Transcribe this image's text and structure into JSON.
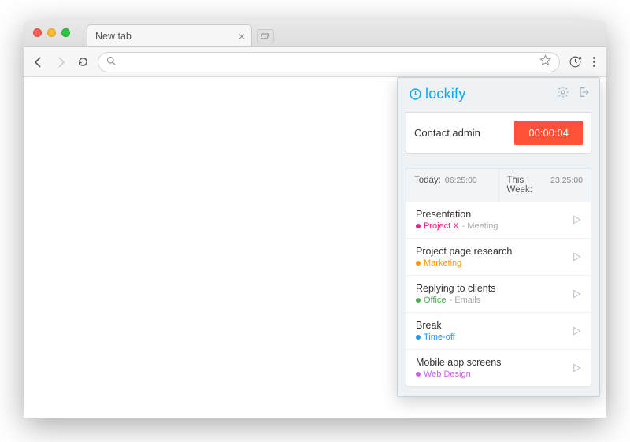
{
  "browser": {
    "tab_title": "New tab"
  },
  "extension": {
    "brand": "lockify",
    "current": {
      "description": "Contact admin",
      "elapsed": "00:00:04"
    },
    "summary": {
      "today_label": "Today:",
      "today_value": "06:25:00",
      "week_label": "This Week:",
      "week_value": "23:25:00"
    },
    "entries": [
      {
        "title": "Presentation",
        "project": "Project X",
        "project_color": "#e91e8c",
        "tag": "Meeting"
      },
      {
        "title": "Project page research",
        "project": "Marketing",
        "project_color": "#ff9800",
        "tag": ""
      },
      {
        "title": "Replying to clients",
        "project": "Office",
        "project_color": "#4caf50",
        "tag": "Emails"
      },
      {
        "title": "Break",
        "project": "Time-off",
        "project_color": "#2196f3",
        "tag": ""
      },
      {
        "title": "Mobile app screens",
        "project": "Web Design",
        "project_color": "#c862e0",
        "tag": ""
      }
    ]
  }
}
